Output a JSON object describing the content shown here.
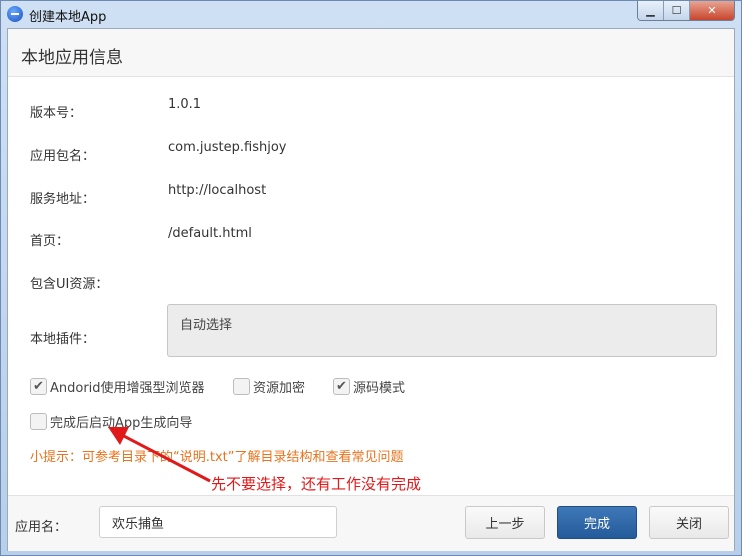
{
  "window": {
    "title": "创建本地App",
    "controls": {
      "minimize": "▁",
      "maximize": "☐",
      "close": "✕"
    }
  },
  "header": {
    "title": "本地应用信息"
  },
  "fields": {
    "version": {
      "label": "版本号：",
      "value": "1.0.1"
    },
    "package": {
      "label": "应用包名：",
      "value": "com.justep.fishjoy"
    },
    "server": {
      "label": "服务地址：",
      "value": "http://localhost"
    },
    "homepage": {
      "label": "首页：",
      "value": "/default.html"
    },
    "ui_resources": {
      "label": "包含UI资源："
    },
    "plugins": {
      "label": "本地插件：",
      "value": "自动选择"
    }
  },
  "options": [
    {
      "label": "Andorid使用增强型浏览器",
      "checked": true
    },
    {
      "label": "资源加密",
      "checked": false
    },
    {
      "label": "源码模式",
      "checked": true
    }
  ],
  "wizard_option": {
    "label": "完成后启动App生成向导",
    "checked": false
  },
  "hint": "小提示：可参考目录下的“说明.txt”了解目录结构和查看常见问题",
  "annotation": "先不要选择，还有工作没有完成",
  "footer": {
    "app_name_label": "应用名：",
    "app_name_value": "欢乐捕鱼",
    "prev_button": "上一步",
    "finish_button": "完成",
    "close_button": "关闭"
  },
  "colors": {
    "accent": "#2d66a8",
    "hint": "#e8731c",
    "annotation": "#e0191a"
  }
}
